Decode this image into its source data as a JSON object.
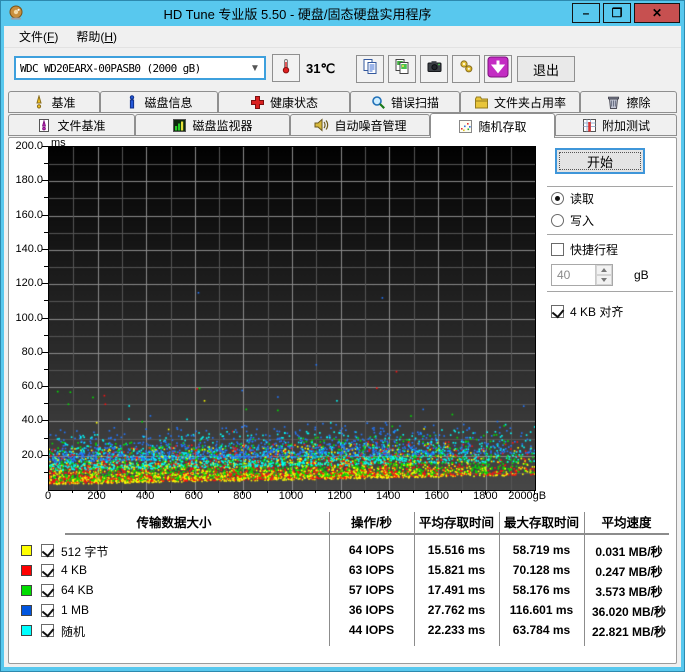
{
  "window": {
    "title": "HD Tune 专业版 5.50 - 硬盘/固态硬盘实用程序",
    "controls": {
      "minimize": "–",
      "maximize": "❐",
      "close": "✕"
    }
  },
  "menu": {
    "items": [
      {
        "pre": "文件(",
        "key": "F",
        "post": ")"
      },
      {
        "pre": "帮助(",
        "key": "H",
        "post": ")"
      }
    ]
  },
  "toolbar": {
    "drive_selector": {
      "value": "WDC WD20EARX-00PASB0 (2000 gB)"
    },
    "temperature": "31℃",
    "buttons": [
      {
        "name": "copy-text-button",
        "icon": "copy-text-icon"
      },
      {
        "name": "copy-image-button",
        "icon": "copy-image-icon"
      },
      {
        "name": "screenshot-button",
        "icon": "camera-icon"
      },
      {
        "name": "options-button",
        "icon": "gears-icon"
      },
      {
        "name": "save-results-button",
        "icon": "download-icon"
      }
    ],
    "exit_label": "退出"
  },
  "tabs": {
    "active": "随机存取",
    "row1": [
      {
        "label": "基准",
        "icon": "benchmark-icon"
      },
      {
        "label": "磁盘信息",
        "icon": "info-icon"
      },
      {
        "label": "健康状态",
        "icon": "health-icon"
      },
      {
        "label": "错误扫描",
        "icon": "scan-icon"
      },
      {
        "label": "文件夹占用率",
        "icon": "folder-icon"
      },
      {
        "label": "擦除",
        "icon": "erase-icon"
      }
    ],
    "row2": [
      {
        "label": "文件基准",
        "icon": "file-benchmark-icon"
      },
      {
        "label": "磁盘监视器",
        "icon": "monitor-icon"
      },
      {
        "label": "自动噪音管理",
        "icon": "aam-icon"
      },
      {
        "label": "随机存取",
        "icon": "random-access-icon"
      },
      {
        "label": "附加测试",
        "icon": "extra-tests-icon"
      }
    ]
  },
  "chart_data": {
    "type": "scatter",
    "xlabel": "gB",
    "ylabel": "ms",
    "xlim": [
      0,
      2000
    ],
    "ylim": [
      0,
      200
    ],
    "grid": {
      "x_minor": 100,
      "x_major": 200,
      "y_minor": 10,
      "y_major": 20
    },
    "x_tick_labels": [
      "0",
      "200",
      "400",
      "600",
      "800",
      "1000",
      "1200",
      "1400",
      "1600",
      "1800",
      "2000gB"
    ],
    "y_tick_labels": [
      "200.0",
      "180.0",
      "160.0",
      "140.0",
      "120.0",
      "100.0",
      "80.0",
      "60.0",
      "40.0",
      "20.0"
    ],
    "base_min_ms": [
      3.2,
      8.5
    ],
    "seed": 1337,
    "series": [
      {
        "name": "512 字节",
        "color": "#ffff00",
        "iops": 64,
        "avg_access_ms": 15.516,
        "max_access_ms": 58.719,
        "avg_speed_mb_s": 0.031,
        "n": 1500,
        "band_offset": 0,
        "band_spread": 8
      },
      {
        "name": "4 KB",
        "color": "#ff1010",
        "iops": 63,
        "avg_access_ms": 15.821,
        "max_access_ms": 70.128,
        "avg_speed_mb_s": 0.247,
        "n": 1400,
        "band_offset": 0.4,
        "band_spread": 8.2
      },
      {
        "name": "64 KB",
        "color": "#00e400",
        "iops": 57,
        "avg_access_ms": 17.491,
        "max_access_ms": 58.176,
        "avg_speed_mb_s": 3.573,
        "n": 1400,
        "band_offset": 1.2,
        "band_spread": 9
      },
      {
        "name": "1 MB",
        "color": "#2277ff",
        "iops": 36,
        "avg_access_ms": 27.762,
        "max_access_ms": 116.601,
        "avg_speed_mb_s": 36.02,
        "n": 1150,
        "band_offset": 13,
        "band_spread": 7.5
      },
      {
        "name": "随机",
        "color": "#00ffff",
        "iops": 44,
        "avg_access_ms": 22.233,
        "max_access_ms": 63.784,
        "avg_speed_mb_s": 22.821,
        "n": 1150,
        "band_offset": 8,
        "band_spread": 8
      }
    ],
    "outliers": [
      {
        "series": 3,
        "x": 615,
        "y": 115
      },
      {
        "series": 3,
        "x": 1372,
        "y": 112
      },
      {
        "series": 3,
        "x": 1100,
        "y": 73
      },
      {
        "series": 1,
        "x": 1430,
        "y": 69
      },
      {
        "series": 1,
        "x": 228,
        "y": 55
      },
      {
        "series": 1,
        "x": 232,
        "y": 50
      },
      {
        "series": 2,
        "x": 88,
        "y": 57
      },
      {
        "series": 2,
        "x": 80,
        "y": 50
      },
      {
        "series": 0,
        "x": 640,
        "y": 52
      },
      {
        "series": 1,
        "x": 610,
        "y": 59
      },
      {
        "series": 2,
        "x": 812,
        "y": 47
      },
      {
        "series": 3,
        "x": 795,
        "y": 58
      },
      {
        "series": 4,
        "x": 330,
        "y": 49
      },
      {
        "series": 4,
        "x": 1185,
        "y": 52
      },
      {
        "series": 2,
        "x": 1660,
        "y": 44
      },
      {
        "series": 3,
        "x": 1540,
        "y": 47
      }
    ]
  },
  "controls": {
    "start_label": "开始",
    "read_label": "读取",
    "write_label": "写入",
    "mode": "read",
    "short_stroke_label": "快捷行程",
    "short_stroke_checked": false,
    "short_stroke_value": "40",
    "short_stroke_unit": "gB",
    "align_label": "4 KB 对齐",
    "align_checked": true
  },
  "results_table": {
    "headers": [
      "传输数据大小",
      "操作/秒",
      "平均存取时间",
      "最大存取时间",
      "平均速度"
    ],
    "rows": [
      {
        "color": "#ffff00",
        "checked": true,
        "label": "512 字节",
        "ops": "64 IOPS",
        "avg": "15.516 ms",
        "max": "58.719 ms",
        "speed": "0.031 MB/秒"
      },
      {
        "color": "#ff0000",
        "checked": true,
        "label": "4 KB",
        "ops": "63 IOPS",
        "avg": "15.821 ms",
        "max": "70.128 ms",
        "speed": "0.247 MB/秒"
      },
      {
        "color": "#00dd00",
        "checked": true,
        "label": "64 KB",
        "ops": "57 IOPS",
        "avg": "17.491 ms",
        "max": "58.176 ms",
        "speed": "3.573 MB/秒"
      },
      {
        "color": "#0055e0",
        "checked": true,
        "label": "1 MB",
        "ops": "36 IOPS",
        "avg": "27.762 ms",
        "max": "116.601 ms",
        "speed": "36.020 MB/秒"
      },
      {
        "color": "#00ffff",
        "checked": true,
        "label": "随机",
        "ops": "44 IOPS",
        "avg": "22.233 ms",
        "max": "63.784 ms",
        "speed": "22.821 MB/秒"
      }
    ]
  }
}
